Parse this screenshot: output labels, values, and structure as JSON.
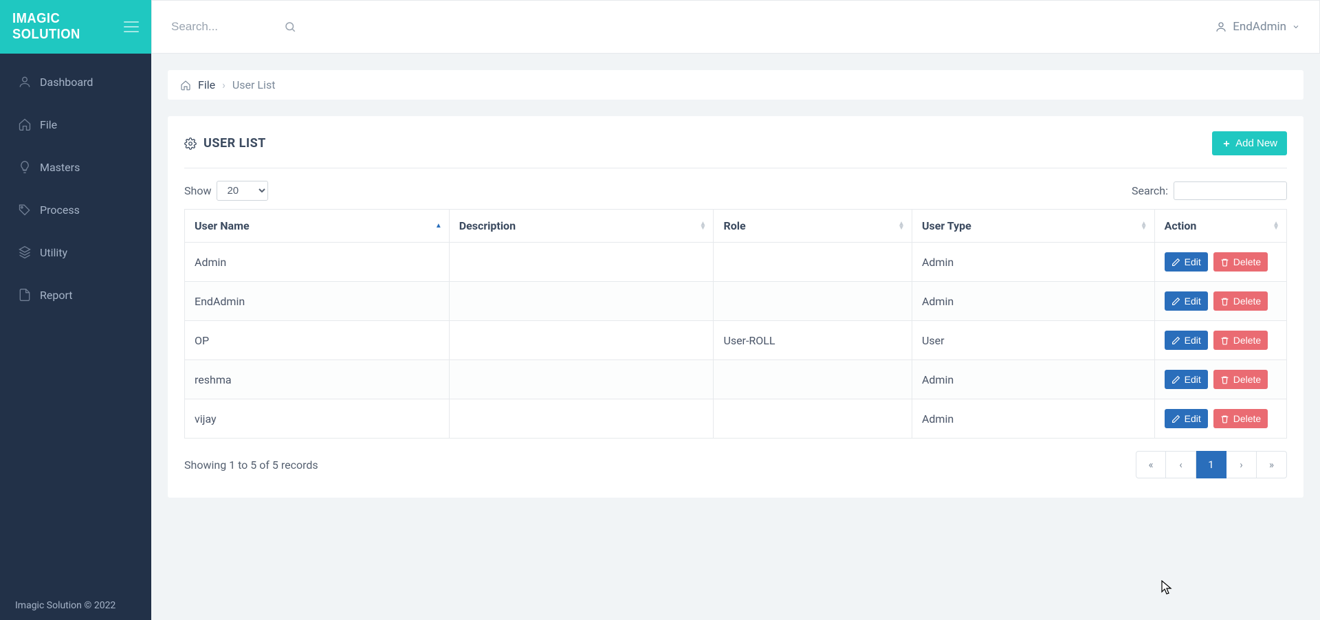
{
  "brand": "IMAGIC SOLUTION",
  "footer_text": "Imagic Solution © 2022",
  "topbar": {
    "search_placeholder": "Search...",
    "user_name": "EndAdmin"
  },
  "sidebar": {
    "items": [
      {
        "label": "Dashboard"
      },
      {
        "label": "File"
      },
      {
        "label": "Masters"
      },
      {
        "label": "Process"
      },
      {
        "label": "Utility"
      },
      {
        "label": "Report"
      }
    ]
  },
  "breadcrumb": {
    "root": "File",
    "current": "User List"
  },
  "page": {
    "title": "USER LIST",
    "add_new_label": "Add New",
    "show_label": "Show",
    "show_value": "20",
    "search_label": "Search:",
    "info_text": "Showing 1 to 5 of 5 records",
    "page_number": "1",
    "edit_label": "Edit",
    "delete_label": "Delete",
    "columns": [
      "User Name",
      "Description",
      "Role",
      "User Type",
      "Action"
    ],
    "rows": [
      {
        "username": "Admin",
        "description": "",
        "role": "",
        "usertype": "Admin"
      },
      {
        "username": "EndAdmin",
        "description": "",
        "role": "",
        "usertype": "Admin"
      },
      {
        "username": "OP",
        "description": "",
        "role": "User-ROLL",
        "usertype": "User"
      },
      {
        "username": "reshma",
        "description": "",
        "role": "",
        "usertype": "Admin"
      },
      {
        "username": "vijay",
        "description": "",
        "role": "",
        "usertype": "Admin"
      }
    ]
  }
}
